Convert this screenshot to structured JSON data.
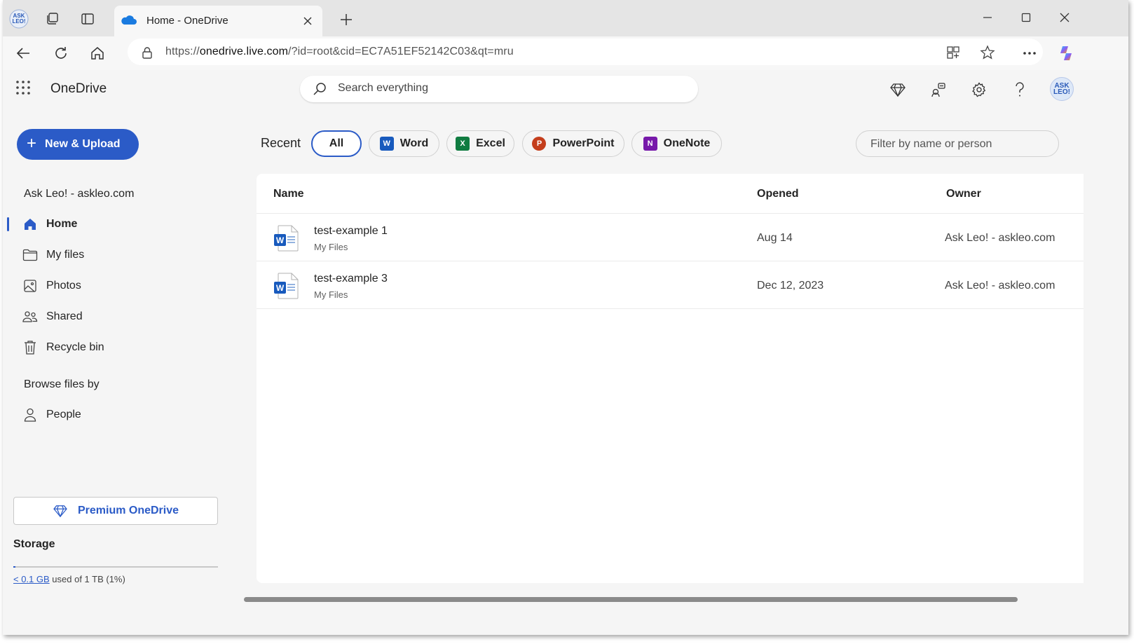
{
  "browser": {
    "tab_title": "Home - OneDrive",
    "url_prefix": "https://",
    "url_host": "onedrive.live.com",
    "url_path": "/?id=root&cid=EC7A51EF52142C03&qt=mru"
  },
  "app": {
    "name": "OneDrive",
    "search_placeholder": "Search everything",
    "avatar_text": "ASK LEO!"
  },
  "sidebar": {
    "new_upload_label": "New & Upload",
    "account_name": "Ask Leo! - askleo.com",
    "items": [
      {
        "label": "Home",
        "icon": "home-icon",
        "active": true
      },
      {
        "label": "My files",
        "icon": "folder-icon"
      },
      {
        "label": "Photos",
        "icon": "photos-icon"
      },
      {
        "label": "Shared",
        "icon": "people-icon"
      },
      {
        "label": "Recycle bin",
        "icon": "trash-icon"
      }
    ],
    "browse_heading": "Browse files by",
    "browse_items": [
      {
        "label": "People",
        "icon": "person-icon"
      }
    ],
    "premium_label": "Premium OneDrive",
    "storage_heading": "Storage",
    "storage_used": "< 0.1 GB",
    "storage_rest": " used of 1 TB (1%)",
    "storage_fraction": 0.01
  },
  "filters": {
    "recent_label": "Recent",
    "pills": [
      "All",
      "Word",
      "Excel",
      "PowerPoint",
      "OneNote"
    ],
    "filter_placeholder": "Filter by name or person"
  },
  "table": {
    "columns": [
      "Name",
      "Opened",
      "Owner"
    ],
    "rows": [
      {
        "name": "test-example 1",
        "location": "My Files",
        "opened": "Aug 14",
        "owner": "Ask Leo! - askleo.com"
      },
      {
        "name": "test-example 3",
        "location": "My Files",
        "opened": "Dec 12, 2023",
        "owner": "Ask Leo! - askleo.com"
      }
    ]
  },
  "colors": {
    "accent": "#2b5bc7",
    "word": "#185abd",
    "excel": "#107c41",
    "powerpoint": "#c43e1c",
    "onenote": "#7719aa"
  }
}
